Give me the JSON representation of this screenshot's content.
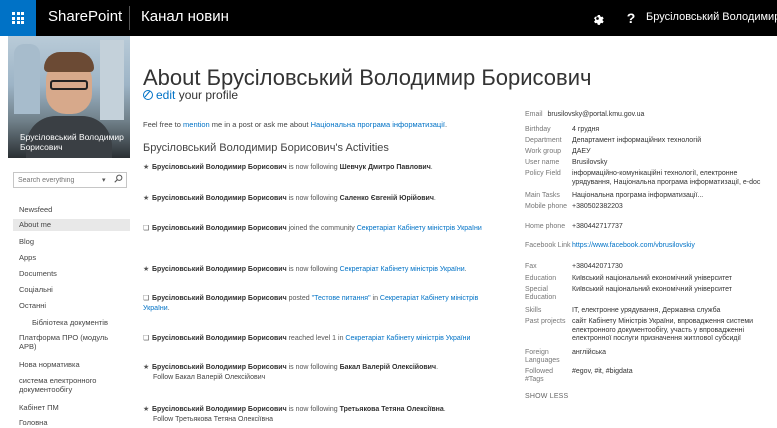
{
  "topbar": {
    "brand": "SharePoint",
    "site_title": "Канал новин",
    "user_name": "Брусіловський Володимир",
    "help_label": "?",
    "waffle_icon": "app-launcher-icon",
    "gear_icon": "gear-icon",
    "colors": {
      "bar": "#000000",
      "waffle": "#0072c6"
    }
  },
  "profile": {
    "photo_caption": "Брусіловський Володимир Борисович"
  },
  "search": {
    "placeholder": "Search everything",
    "caret": "▾",
    "icon": "search-icon"
  },
  "nav": [
    {
      "label": "Newsfeed"
    },
    {
      "label": "About me",
      "active": true
    },
    {
      "label": "Blog"
    },
    {
      "label": "Apps"
    },
    {
      "label": "Documents"
    },
    {
      "label": "Соціальні"
    },
    {
      "label": "Останні"
    },
    {
      "label": "Бібліотека документів",
      "sub": true
    },
    {
      "label": "Платформа ПРО (модуль АРВ)"
    },
    {
      "label": "Нова нормативка"
    },
    {
      "label": "система електронного документообігу"
    },
    {
      "label": "Кабінет ПМ"
    },
    {
      "label": "Головна"
    }
  ],
  "main": {
    "title": "About Брусіловський Володимир Борисович",
    "edit_word": "edit",
    "edit_rest": " your profile",
    "mention": {
      "p1": "Feel free to ",
      "link1": "mention",
      "p2": " me in a post or ask me about ",
      "link2": "Національна програма інформатизації",
      "p3": "."
    },
    "activities_title": "Брусіловський Володимир Борисович's Activities",
    "activities": [
      {
        "icon": "★",
        "actor": "Брусіловський Володимир Борисович",
        "verb": " is now following ",
        "target": "Шевчук Дмитро Павлович",
        "target_bold": true,
        "tail": "."
      },
      {
        "icon": "★",
        "actor": "Брусіловський Володимир Борисович",
        "verb": " is now following ",
        "target": "Саленко Євгеній Юрійович",
        "target_bold": true,
        "tail": "."
      },
      {
        "icon": "❏",
        "actor": "Брусіловський Володимир Борисович",
        "verb": " joined the community ",
        "target": "Секретаріат Кабінету міністрів України",
        "target_bold": false,
        "tail": ""
      },
      {
        "icon": "★",
        "actor": "Брусіловський Володимир Борисович",
        "verb": " is now following ",
        "target": "Секретаріат Кабінету міністрів України",
        "target_bold": false,
        "tail": "."
      },
      {
        "icon": "❏",
        "actor": "Брусіловський Володимир Борисович",
        "verb": " posted ",
        "target": "\"Тестове питання\"",
        "target_bold": false,
        "tail": " in ",
        "target2": "Секретаріат Кабінету міністрів України",
        "tail2": "."
      },
      {
        "icon": "❏",
        "actor": "Брусіловський Володимир Борисович",
        "verb": " reached level 1 in ",
        "target": "Секретаріат Кабінету міністрів України",
        "target_bold": false,
        "tail": ""
      },
      {
        "icon": "★",
        "actor": "Брусіловський Володимир Борисович",
        "verb": " is now following ",
        "target": "Бакал Валерій Олексійович",
        "target_bold": true,
        "tail": ".",
        "follow": "Follow Бакал Валерій Олексійович"
      },
      {
        "icon": "★",
        "actor": "Брусіловський Володимир Борисович",
        "verb": " is now following ",
        "target": "Третьякова Тетяна Олексіївна",
        "target_bold": true,
        "tail": ".",
        "follow": "Follow Третьякова Тетяна Олексіївна"
      }
    ]
  },
  "details": {
    "email_label": "Email",
    "email": "brusilovsky@portal.kmu.gov.ua",
    "rows": [
      {
        "label": "Birthday",
        "value": "4 грудня"
      },
      {
        "label": "Department",
        "value": "Департамент інформаційних технологій"
      },
      {
        "label": "Work group",
        "value": "ДАЕУ"
      },
      {
        "label": "User name",
        "value": "Brusilovsky"
      },
      {
        "label": "Policy Field",
        "value": "інформаційно-комунікаційні технології, електронне урядування, Національна програма інформатизації, е-doc"
      },
      {
        "label": "Main Tasks",
        "value": "Національна програма інформатизації..."
      },
      {
        "label": "Mobile phone",
        "value": "+380502382203"
      },
      {
        "label": "Home phone",
        "value": "+380442717737"
      },
      {
        "label": "Facebook Link",
        "value": "https://www.facebook.com/vbrusilovskiy",
        "link": true
      },
      {
        "label": "Fax",
        "value": "+380442071730"
      },
      {
        "label": "Education",
        "value": "Київський національний економічний університет"
      },
      {
        "label": "Special Education",
        "value": "Київський національний економічний університет"
      },
      {
        "label": "Skills",
        "value": "IT, електронне урядування, Державна служба"
      },
      {
        "label": "Past projects",
        "value": "сайт Кабінету Міністрів України, впровадження системи електронного документообігу, участь у впровадженні електронної послуги призначення житлової субсидії"
      },
      {
        "label": "Foreign Languages",
        "value": "англійська"
      },
      {
        "label": "Followed #Tags",
        "value": "#egov, #it, #bigdata"
      }
    ],
    "show_less": "SHOW LESS"
  }
}
